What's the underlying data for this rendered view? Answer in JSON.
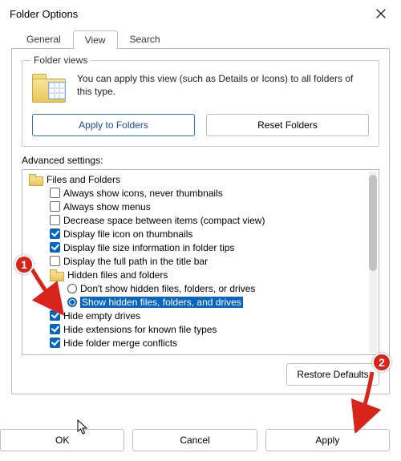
{
  "window": {
    "title": "Folder Options"
  },
  "tabs": {
    "general": "General",
    "view": "View",
    "search": "Search"
  },
  "folderViews": {
    "legend": "Folder views",
    "text": "You can apply this view (such as Details or Icons) to all folders of this type.",
    "applyBtn": "Apply to Folders",
    "resetBtn": "Reset Folders"
  },
  "advanced": {
    "label": "Advanced settings:",
    "root": "Files and Folders",
    "items": [
      {
        "label": "Always show icons, never thumbnails",
        "checked": false
      },
      {
        "label": "Always show menus",
        "checked": false
      },
      {
        "label": "Decrease space between items (compact view)",
        "checked": false
      },
      {
        "label": "Display file icon on thumbnails",
        "checked": true
      },
      {
        "label": "Display file size information in folder tips",
        "checked": true
      },
      {
        "label": "Display the full path in the title bar",
        "checked": false
      }
    ],
    "hiddenGroup": {
      "label": "Hidden files and folders",
      "opt1": "Don't show hidden files, folders, or drives",
      "opt2": "Show hidden files, folders, and drives"
    },
    "tail": [
      {
        "label": "Hide empty drives",
        "checked": true
      },
      {
        "label": "Hide extensions for known file types",
        "checked": true
      },
      {
        "label": "Hide folder merge conflicts",
        "checked": true
      }
    ]
  },
  "buttons": {
    "restore": "Restore Defaults",
    "ok": "OK",
    "cancel": "Cancel",
    "apply": "Apply"
  },
  "annotations": {
    "b1": "1",
    "b2": "2"
  }
}
